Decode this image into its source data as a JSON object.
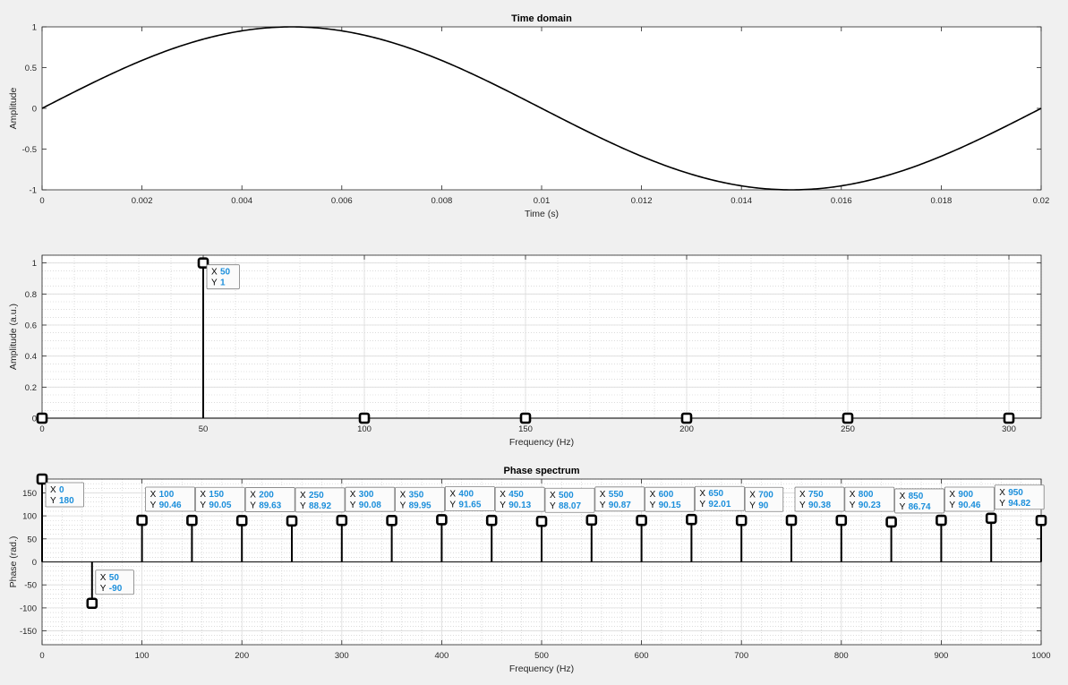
{
  "chart_data": [
    {
      "type": "line",
      "title": "Time domain",
      "xlabel": "Time (s)",
      "ylabel": "Amplitude",
      "xlim": [
        0,
        0.02
      ],
      "ylim": [
        -1,
        1
      ],
      "xticks": [
        "0",
        "0.002",
        "0.004",
        "0.006",
        "0.008",
        "0.01",
        "0.012",
        "0.014",
        "0.016",
        "0.018",
        "0.02"
      ],
      "yticks": [
        "-1",
        "-0.5",
        "0",
        "0.5",
        "1"
      ],
      "grid": false,
      "series": [
        {
          "function": "sin(2*pi*50*t)",
          "frequency_hz": 50,
          "amplitude": 1,
          "t_start": 0,
          "t_end": 0.02
        }
      ]
    },
    {
      "type": "stem",
      "title": "",
      "xlabel": "Frequency (Hz)",
      "ylabel": "Amplitude (a.u.)",
      "xlim": [
        0,
        310
      ],
      "ylim": [
        0,
        1.05
      ],
      "xticks": [
        "0",
        "50",
        "100",
        "150",
        "200",
        "250",
        "300"
      ],
      "yticks": [
        "0",
        "0.2",
        "0.4",
        "0.6",
        "0.8",
        "1"
      ],
      "grid": true,
      "x": [
        0,
        50,
        100,
        150,
        200,
        250,
        300
      ],
      "y": [
        0,
        1,
        0,
        0,
        0,
        0,
        0
      ],
      "datatips": [
        {
          "x": 50,
          "y": "1",
          "xlabel": "X",
          "ylabel": "Y",
          "xval": "50",
          "yval": "1"
        }
      ]
    },
    {
      "type": "stem",
      "title": "Phase spectrum",
      "xlabel": "Frequency (Hz)",
      "ylabel": "Phase (rad.)",
      "xlim": [
        0,
        1000
      ],
      "ylim": [
        -180,
        180
      ],
      "xticks": [
        "0",
        "100",
        "200",
        "300",
        "400",
        "500",
        "600",
        "700",
        "800",
        "900",
        "1000"
      ],
      "yticks": [
        "-150",
        "-100",
        "-50",
        "0",
        "50",
        "100",
        "150"
      ],
      "grid": true,
      "x": [
        0,
        50,
        100,
        150,
        200,
        250,
        300,
        350,
        400,
        450,
        500,
        550,
        600,
        650,
        700,
        750,
        800,
        850,
        900,
        950,
        1000
      ],
      "y": [
        180,
        -90,
        90.46,
        90.05,
        89.63,
        88.92,
        90.08,
        89.95,
        91.65,
        90.13,
        88.07,
        90.87,
        90.15,
        92.01,
        90,
        90.38,
        90.23,
        86.74,
        90.46,
        94.82,
        90
      ],
      "datatips": [
        {
          "x": 0,
          "y": 180,
          "xval": "0",
          "yval": "180"
        },
        {
          "x": 50,
          "y": -90,
          "xval": "50",
          "yval": "-90"
        },
        {
          "x": 100,
          "y": 90.46,
          "xval": "100",
          "yval": "90.46"
        },
        {
          "x": 150,
          "y": 90.05,
          "xval": "150",
          "yval": "90.05"
        },
        {
          "x": 200,
          "y": 89.63,
          "xval": "200",
          "yval": "89.63"
        },
        {
          "x": 250,
          "y": 88.92,
          "xval": "250",
          "yval": "88.92"
        },
        {
          "x": 300,
          "y": 90.08,
          "xval": "300",
          "yval": "90.08"
        },
        {
          "x": 350,
          "y": 89.95,
          "xval": "350",
          "yval": "89.95"
        },
        {
          "x": 400,
          "y": 91.65,
          "xval": "400",
          "yval": "91.65"
        },
        {
          "x": 450,
          "y": 90.13,
          "xval": "450",
          "yval": "90.13"
        },
        {
          "x": 500,
          "y": 88.07,
          "xval": "500",
          "yval": "88.07"
        },
        {
          "x": 550,
          "y": 90.87,
          "xval": "550",
          "yval": "90.87"
        },
        {
          "x": 600,
          "y": 90.15,
          "xval": "600",
          "yval": "90.15"
        },
        {
          "x": 650,
          "y": 92.01,
          "xval": "650",
          "yval": "92.01"
        },
        {
          "x": 700,
          "y": 90,
          "xval": "700",
          "yval": "90"
        },
        {
          "x": 750,
          "y": 90.38,
          "xval": "750",
          "yval": "90.38"
        },
        {
          "x": 800,
          "y": 90.23,
          "xval": "800",
          "yval": "90.23"
        },
        {
          "x": 850,
          "y": 86.74,
          "xval": "850",
          "yval": "86.74"
        },
        {
          "x": 900,
          "y": 90.46,
          "xval": "900",
          "yval": "90.46"
        },
        {
          "x": 950,
          "y": 94.82,
          "xval": "950",
          "yval": "94.82"
        }
      ]
    }
  ],
  "colors": {
    "figure_bg": "#f0f0f0",
    "axes_bg": "#ffffff",
    "line": "#000000",
    "datatip_value": "#1c8fdb"
  }
}
